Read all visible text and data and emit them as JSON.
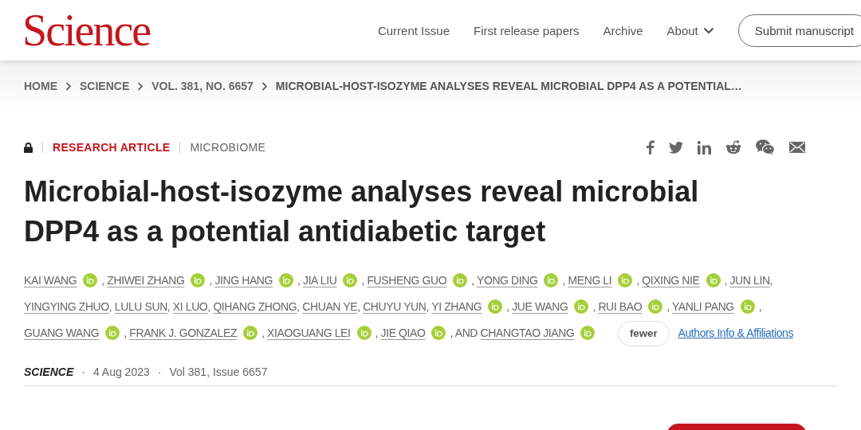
{
  "header": {
    "logo": "Science",
    "nav": [
      {
        "label": "Current Issue",
        "dropdown": false
      },
      {
        "label": "First release papers",
        "dropdown": false
      },
      {
        "label": "Archive",
        "dropdown": false
      },
      {
        "label": "About",
        "dropdown": true
      }
    ],
    "submit": "Submit manuscript"
  },
  "breadcrumb": [
    "HOME",
    "SCIENCE",
    "VOL. 381, NO. 6657",
    "MICROBIAL-HOST-ISOZYME ANALYSES REVEAL MICROBIAL DPP4 AS A POTENTIAL…"
  ],
  "article": {
    "locked": true,
    "type": "RESEARCH ARTICLE",
    "section": "MICROBIOME",
    "share": [
      {
        "kind": "facebook"
      },
      {
        "kind": "twitter"
      },
      {
        "kind": "linkedin"
      },
      {
        "kind": "reddit"
      },
      {
        "kind": "wechat"
      },
      {
        "kind": "email"
      }
    ],
    "title": "Microbial-host-isozyme analyses reveal microbial DPP4 as a potential antidiabetic target",
    "separator": ",",
    "last_joiner": "AND",
    "authors": [
      {
        "name": "KAI WANG",
        "orcid": true
      },
      {
        "name": "ZHIWEI ZHANG",
        "orcid": true
      },
      {
        "name": "JING HANG",
        "orcid": true
      },
      {
        "name": "JIA LIU",
        "orcid": true
      },
      {
        "name": "FUSHENG GUO",
        "orcid": true
      },
      {
        "name": "YONG DING",
        "orcid": true
      },
      {
        "name": "MENG LI",
        "orcid": true
      },
      {
        "name": "QIXING NIE",
        "orcid": true
      },
      {
        "name": "JUN LIN",
        "orcid": false
      },
      {
        "name": "YINGYING ZHUO",
        "orcid": false
      },
      {
        "name": "LULU SUN",
        "orcid": false
      },
      {
        "name": "XI LUO",
        "orcid": false
      },
      {
        "name": "QIHANG ZHONG",
        "orcid": false
      },
      {
        "name": "CHUAN YE",
        "orcid": false
      },
      {
        "name": "CHUYU YUN",
        "orcid": false
      },
      {
        "name": "YI ZHANG",
        "orcid": true
      },
      {
        "name": "JUE WANG",
        "orcid": true
      },
      {
        "name": "RUI BAO",
        "orcid": true
      },
      {
        "name": "YANLI PANG",
        "orcid": true
      },
      {
        "name": "GUANG WANG",
        "orcid": true
      },
      {
        "name": "FRANK J. GONZALEZ",
        "orcid": true
      },
      {
        "name": "XIAOGUANG LEI",
        "orcid": true
      },
      {
        "name": "JIE QIAO",
        "orcid": true
      },
      {
        "name": "CHANGTAO JIANG",
        "orcid": true
      }
    ],
    "fewer": "fewer",
    "affiliations_link": "Authors Info & Affiliations",
    "journal": "SCIENCE",
    "bullet": "·",
    "date": "4 Aug 2023",
    "issue": "Vol 381, Issue 6657"
  }
}
